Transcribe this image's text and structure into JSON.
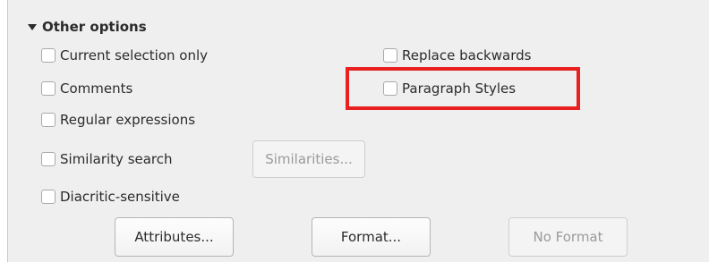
{
  "section": {
    "title": "Other options",
    "expanded": true
  },
  "options": {
    "current_selection_only": {
      "label": "Current selection only",
      "checked": false
    },
    "comments": {
      "label": "Comments",
      "checked": false
    },
    "regular_expressions": {
      "label": "Regular expressions",
      "checked": false
    },
    "similarity_search": {
      "label": "Similarity search",
      "checked": false
    },
    "diacritic_sensitive": {
      "label": "Diacritic-sensitive",
      "checked": false
    },
    "replace_backwards": {
      "label": "Replace backwards",
      "checked": false
    },
    "paragraph_styles": {
      "label": "Paragraph Styles",
      "checked": false
    }
  },
  "buttons": {
    "similarities": {
      "label": "Similarities...",
      "enabled": false
    },
    "attributes": {
      "label": "Attributes...",
      "enabled": true
    },
    "format": {
      "label": "Format...",
      "enabled": true
    },
    "no_format": {
      "label": "No Format",
      "enabled": false
    }
  },
  "colors": {
    "highlight": "#e82020",
    "panel": "#efefef"
  }
}
